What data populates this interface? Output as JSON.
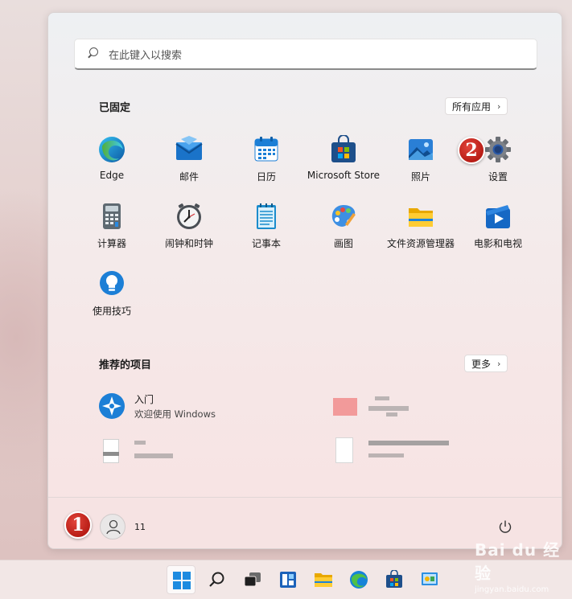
{
  "search": {
    "placeholder": "在此键入以搜索"
  },
  "pinned": {
    "title": "已固定",
    "all_apps": "所有应用",
    "apps": [
      {
        "label": "Edge",
        "icon": "edge-icon"
      },
      {
        "label": "邮件",
        "icon": "mail-icon"
      },
      {
        "label": "日历",
        "icon": "calendar-icon"
      },
      {
        "label": "Microsoft Store",
        "icon": "store-icon"
      },
      {
        "label": "照片",
        "icon": "photos-icon"
      },
      {
        "label": "设置",
        "icon": "settings-icon"
      },
      {
        "label": "计算器",
        "icon": "calculator-icon"
      },
      {
        "label": "闹钟和时钟",
        "icon": "clock-icon"
      },
      {
        "label": "记事本",
        "icon": "notepad-icon"
      },
      {
        "label": "画图",
        "icon": "paint-icon"
      },
      {
        "label": "文件资源管理器",
        "icon": "folder-icon"
      },
      {
        "label": "电影和电视",
        "icon": "movies-icon"
      },
      {
        "label": "使用技巧",
        "icon": "tips-icon"
      }
    ]
  },
  "recommended": {
    "title": "推荐的项目",
    "more": "更多",
    "items": [
      {
        "name": "入门",
        "subtitle": "欢迎使用 Windows",
        "icon": "get-started-icon"
      }
    ]
  },
  "footer": {
    "username": "11"
  },
  "markers": {
    "one": "1",
    "two": "2"
  },
  "watermark": {
    "line1": "Bai du 经验",
    "line2": "jingyan.baidu.com"
  },
  "colors": {
    "accent": "#0078d4",
    "marker": "#c8221b"
  }
}
